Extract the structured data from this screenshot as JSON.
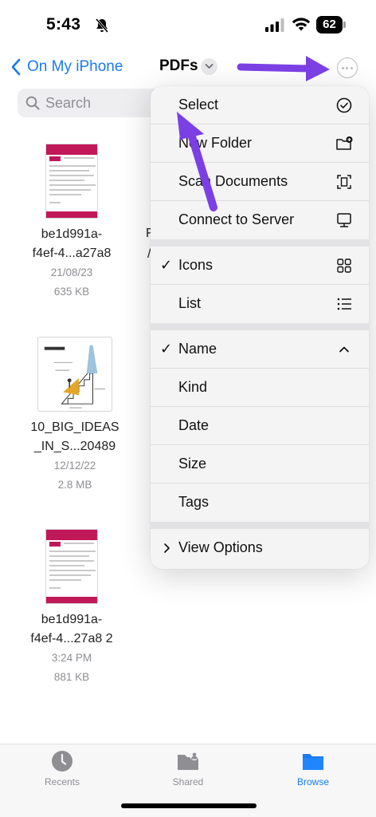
{
  "status_bar": {
    "time": "5:43",
    "battery": "62"
  },
  "nav": {
    "back_label": "On My iPhone",
    "title": "PDFs"
  },
  "search": {
    "placeholder": "Search"
  },
  "files": [
    {
      "name_line1": "be1d991a-",
      "name_line2": "f4ef-4...a27a8",
      "date": "21/08/23",
      "size": "635 KB"
    },
    {
      "name_line1": "10_BIG_IDEAS",
      "name_line2": "_IN_S...20489",
      "date": "12/12/22",
      "size": "2.8 MB"
    },
    {
      "name_line1": "be1d991a-",
      "name_line2": "f4ef-4...27a8 2",
      "date": "3:24 PM",
      "size": "881 KB"
    }
  ],
  "partial_column": {
    "line1": "F",
    "line2": "/"
  },
  "menu": {
    "section1": [
      {
        "label": "Select",
        "icon": "checkmark-circle-icon"
      },
      {
        "label": "New Folder",
        "icon": "folder-plus-icon"
      },
      {
        "label": "Scan Documents",
        "icon": "scan-document-icon"
      },
      {
        "label": "Connect to Server",
        "icon": "server-display-icon"
      }
    ],
    "section2": [
      {
        "label": "Icons",
        "checked": "✓",
        "icon": "grid-icon"
      },
      {
        "label": "List",
        "checked": "",
        "icon": "list-icon"
      }
    ],
    "section3": [
      {
        "label": "Name",
        "checked": "✓",
        "icon": "chevron-up-icon"
      },
      {
        "label": "Kind",
        "checked": ""
      },
      {
        "label": "Date",
        "checked": ""
      },
      {
        "label": "Size",
        "checked": ""
      },
      {
        "label": "Tags",
        "checked": ""
      }
    ],
    "section4": {
      "label": "View Options",
      "marker": "›"
    }
  },
  "tabs": [
    {
      "label": "Recents",
      "icon": "clock-icon",
      "active": false
    },
    {
      "label": "Shared",
      "icon": "shared-folder-icon",
      "active": false
    },
    {
      "label": "Browse",
      "icon": "folder-icon",
      "active": true
    }
  ],
  "colors": {
    "accent": "#1a7bf0",
    "annotation_arrow": "#7b3fe4",
    "pdf_brand": "#c1185a"
  }
}
